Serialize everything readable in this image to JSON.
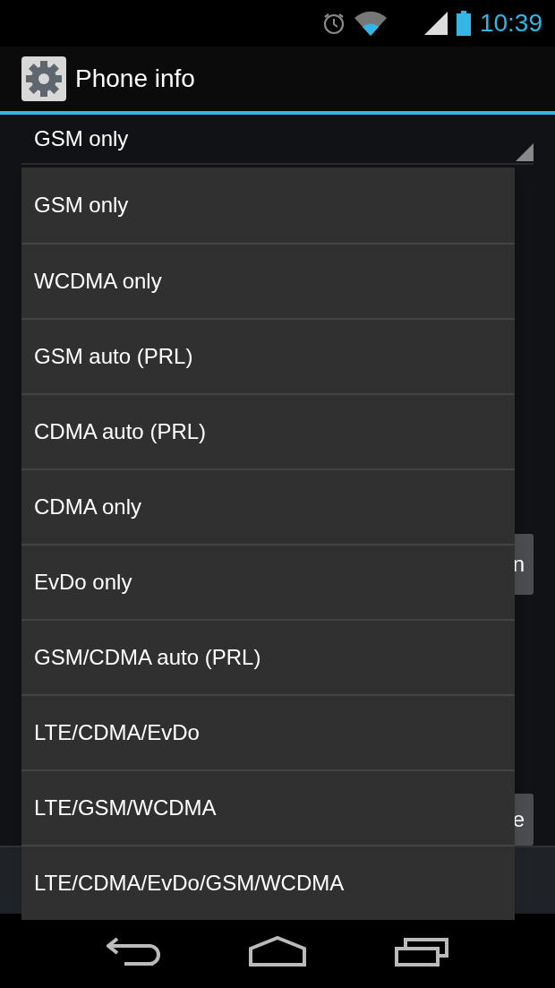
{
  "status_bar": {
    "time": "10:39"
  },
  "action_bar": {
    "title": "Phone info"
  },
  "spinner": {
    "value": "GSM only"
  },
  "background_rows": [
    {
      "button": "n"
    },
    {
      "button": "e"
    }
  ],
  "dropdown": {
    "items": [
      {
        "label": "GSM only"
      },
      {
        "label": "WCDMA only"
      },
      {
        "label": "GSM auto (PRL)"
      },
      {
        "label": "CDMA auto (PRL)"
      },
      {
        "label": "CDMA only"
      },
      {
        "label": "EvDo only"
      },
      {
        "label": "GSM/CDMA auto (PRL)"
      },
      {
        "label": "LTE/CDMA/EvDo"
      },
      {
        "label": "LTE/GSM/WCDMA"
      },
      {
        "label": "LTE/CDMA/EvDo/GSM/WCDMA"
      }
    ]
  }
}
